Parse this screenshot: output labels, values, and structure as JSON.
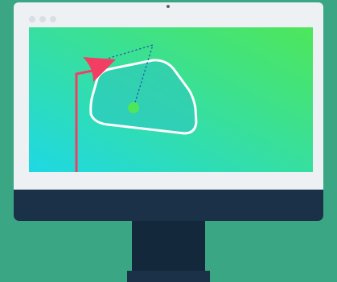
{
  "illustration": {
    "subject": "desktop-monitor",
    "window_controls": [
      "dot",
      "dot",
      "dot"
    ],
    "screen_gradient": [
      "#1fd8e4",
      "#4ee65a"
    ],
    "shape_outline_color": "#ffffff",
    "shape_fill_color": "#2ec4c0",
    "center_point_color": "#4ee65a",
    "cursor_color": "#f33e63",
    "connector_line_color": "#1f5fa6"
  },
  "colors": {
    "background": "#3aa683",
    "bezel": "#eef1f4",
    "chin": "#1b3147",
    "stand": "#13283b"
  }
}
